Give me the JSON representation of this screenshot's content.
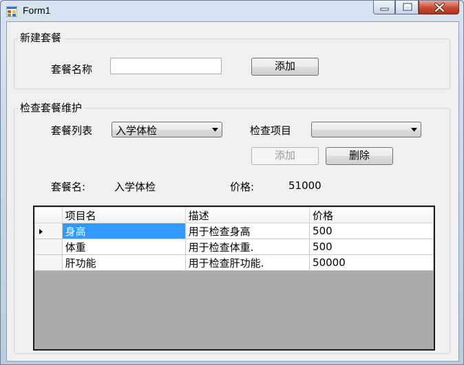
{
  "window": {
    "title": "Form1"
  },
  "new_package": {
    "group_title": "新建套餐",
    "name_label": "套餐名称",
    "name_value": "",
    "add_button": "添加"
  },
  "maintenance": {
    "group_title": "检查套餐维护",
    "list_label": "套餐列表",
    "list_selected": "入学体检",
    "item_label": "检查项目",
    "item_selected": "",
    "add_button": "添加",
    "delete_button": "删除",
    "package_name_label": "套餐名:",
    "package_name_value": "入学体检",
    "price_label": "价格:",
    "price_value": "51000"
  },
  "grid": {
    "columns": [
      "项目名",
      "描述",
      "价格"
    ],
    "rows": [
      [
        "身高",
        "用于检查身高",
        "500"
      ],
      [
        "体重",
        "用于检查体重.",
        "500"
      ],
      [
        "肝功能",
        "用于检查肝功能.",
        "50000"
      ]
    ]
  },
  "icons": {
    "app": "form-app-icon",
    "minimize": "minimize-icon",
    "maximize": "maximize-icon",
    "close": "close-icon",
    "dropdown": "chevron-down-icon",
    "row_pointer": "row-pointer-icon"
  },
  "colors": {
    "selected_cell": "#3399ff",
    "grid_background": "#ababab",
    "close_button": "#c74a33"
  }
}
